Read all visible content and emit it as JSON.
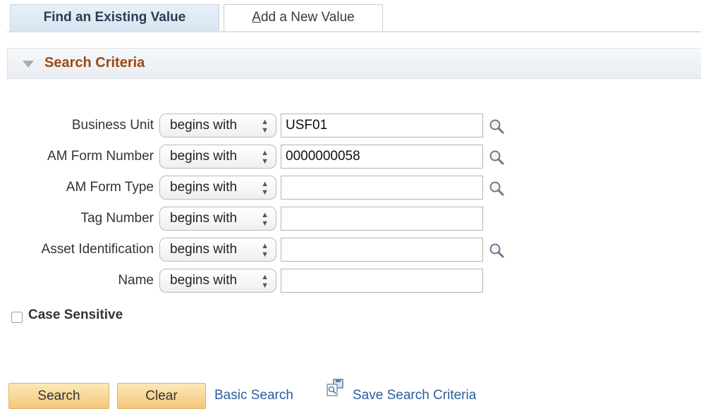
{
  "tabs": [
    {
      "label": "Find an Existing Value",
      "active": true
    },
    {
      "label_underlined": "A",
      "label_rest": "dd a New Value",
      "active": false
    }
  ],
  "section": {
    "title": "Search Criteria"
  },
  "operator_default": "begins with",
  "fields": [
    {
      "label": "Business Unit",
      "operator": "begins with",
      "value": "USF01",
      "lookup": true
    },
    {
      "label": "AM Form Number",
      "operator": "begins with",
      "value": "0000000058",
      "lookup": true
    },
    {
      "label": "AM Form Type",
      "operator": "begins with",
      "value": "",
      "lookup": true
    },
    {
      "label": "Tag Number",
      "operator": "begins with",
      "value": "",
      "lookup": false
    },
    {
      "label": "Asset Identification",
      "operator": "begins with",
      "value": "",
      "lookup": true
    },
    {
      "label": "Name",
      "operator": "begins with",
      "value": "",
      "lookup": false
    }
  ],
  "case_sensitive": {
    "label": "Case Sensitive",
    "checked": false
  },
  "buttons": {
    "search": "Search",
    "clear": "Clear"
  },
  "links": {
    "basic_search": "Basic Search",
    "save_search": "Save Search Criteria"
  },
  "colors": {
    "section_title": "#9c4a12",
    "link": "#2a5d9f",
    "button": "#f5c77a"
  },
  "icons": {
    "lookup": "magnifier-icon",
    "save": "save-search-icon",
    "collapse": "triangle-down-icon"
  }
}
